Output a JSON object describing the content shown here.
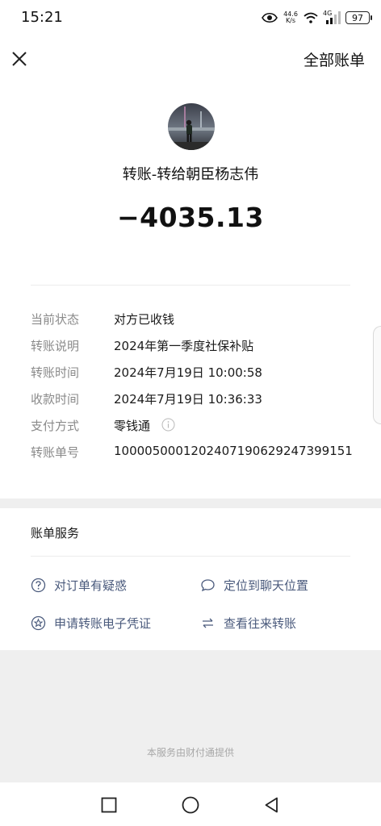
{
  "status_bar": {
    "time": "15:21",
    "net_speed_value": "44.6",
    "net_speed_unit": "K/s",
    "signal_label": "4G",
    "battery": "97"
  },
  "header": {
    "close_icon": "close-icon",
    "right_link": "全部账单"
  },
  "transaction": {
    "title": "转账-转给朝臣杨志伟",
    "amount": "−4035.13"
  },
  "details": [
    {
      "label": "当前状态",
      "value": "对方已收钱"
    },
    {
      "label": "转账说明",
      "value": "2024年第一季度社保补贴"
    },
    {
      "label": "转账时间",
      "value": "2024年7月19日 10:00:58"
    },
    {
      "label": "收款时间",
      "value": "2024年7月19日 10:36:33"
    },
    {
      "label": "支付方式",
      "value": "零钱通",
      "icon": "info-icon"
    },
    {
      "label": "转账单号",
      "value": "1000050001202407190629247399151"
    }
  ],
  "service": {
    "title": "账单服务",
    "items": [
      {
        "label": "对订单有疑惑",
        "icon": "question-circle-icon"
      },
      {
        "label": "定位到聊天位置",
        "icon": "chat-bubble-icon"
      },
      {
        "label": "申请转账电子凭证",
        "icon": "star-circle-icon"
      },
      {
        "label": "查看往来转账",
        "icon": "swap-arrows-icon"
      }
    ]
  },
  "footer": {
    "note": "本服务由财付通提供"
  },
  "colors": {
    "link": "#4a5a7c",
    "label_gray": "#8a8a8a",
    "background": "#efefef"
  }
}
